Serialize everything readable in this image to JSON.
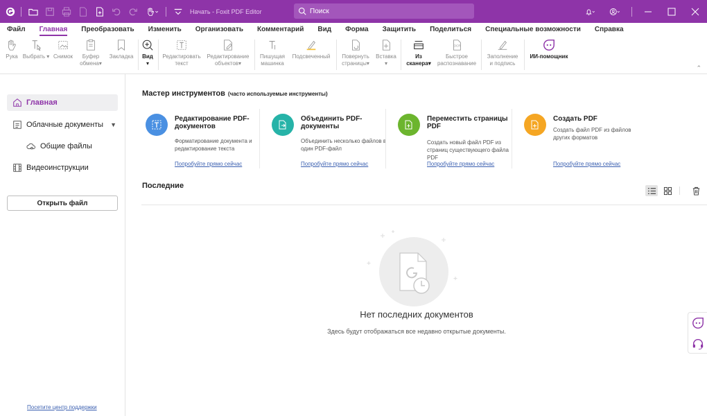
{
  "titlebar": {
    "title": "Начать - Foxit PDF Editor",
    "search_placeholder": "Поиск"
  },
  "menu": {
    "items": [
      "Файл",
      "Главная",
      "Преобразовать",
      "Изменить",
      "Организовать",
      "Комментарий",
      "Вид",
      "Форма",
      "Защитить",
      "Поделиться",
      "Специальные возможности",
      "Справка"
    ],
    "active": "Главная"
  },
  "ribbon": {
    "hand": "Рука",
    "select": "Выбрать",
    "snapshot": "Снимок",
    "clipboard_1": "Буфер",
    "clipboard_2": "обмена",
    "bookmark": "Закладка",
    "view": "Вид",
    "edit_text_1": "Редактировать",
    "edit_text_2": "текст",
    "edit_object_1": "Редактирование",
    "edit_object_2": "объектов",
    "typewriter_1": "Пишущая",
    "typewriter_2": "машинка",
    "highlight": "Подсвеченный",
    "rotate_1": "Повернуть",
    "rotate_2": "страницы",
    "insert": "Вставка",
    "scanner_1": "Из",
    "scanner_2": "сканера",
    "ocr_1": "Быстрое",
    "ocr_2": "распознавание",
    "fill_sign_1": "Заполнение",
    "fill_sign_2": "и подпись",
    "ai": "ИИ-помощник"
  },
  "sidebar": {
    "home": "Главная",
    "cloud": "Облачные документы",
    "shared": "Общие файлы",
    "video": "Видеоинструкции",
    "open_file": "Открыть файл",
    "support": "Посетите центр поддержки"
  },
  "main": {
    "wizard_title": "Мастер инструментов",
    "wizard_sub": "(часто используемые инструменты)",
    "cards": [
      {
        "title": "Редактирование PDF-документов",
        "desc": "Форматирование документа и редактирование текста",
        "link": "Попробуйте прямо сейчас",
        "color": "#4a90e2"
      },
      {
        "title": "Объединить PDF-документы",
        "desc": "Объединить несколько файлов в один PDF-файл",
        "link": "Попробуйте прямо сейчас",
        "color": "#26b3a8"
      },
      {
        "title": "Переместить страницы PDF",
        "desc": "Создать новый файл PDF из страниц существующего файла PDF",
        "link": "Попробуйте прямо сейчас",
        "color": "#6cb52e"
      },
      {
        "title": "Создать PDF",
        "desc": "Создать файл PDF из файлов других форматов",
        "link": "Попробуйте прямо сейчас",
        "color": "#f5a623"
      }
    ],
    "recent_title": "Последние",
    "empty_title": "Нет последних документов",
    "empty_sub": "Здесь будут отображаться все недавно открытые документы."
  },
  "colors": {
    "brand": "#8e34a8",
    "link": "#3a5fb0"
  }
}
